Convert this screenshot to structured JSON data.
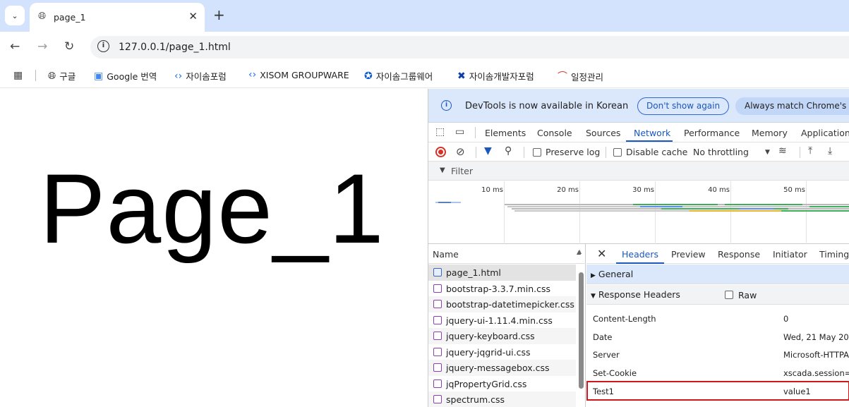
{
  "browser": {
    "tab_title": "page_1",
    "url": "127.0.0.1/page_1.html",
    "bookmarks": [
      {
        "label": "구글",
        "icon": "globe-icon"
      },
      {
        "label": "Google 번역",
        "icon": "translate-icon"
      },
      {
        "label": "자이솜포럼",
        "icon": "xisom-icon"
      },
      {
        "label": "XISOM GROUPWARE",
        "icon": "xisom-icon"
      },
      {
        "label": "자이솜그룹웨어",
        "icon": "groupware-icon"
      },
      {
        "label": "자이솜개발자포럼",
        "icon": "dev-forum-icon"
      },
      {
        "label": "일정관리",
        "icon": "calendar-icon"
      }
    ]
  },
  "page": {
    "heading": "Page_1"
  },
  "devtools": {
    "info_bar": {
      "message": "DevTools is now available in Korean",
      "dont_show": "Don't show again",
      "always_match": "Always match Chrome's la"
    },
    "tabs": [
      "Elements",
      "Console",
      "Sources",
      "Network",
      "Performance",
      "Memory",
      "Application"
    ],
    "active_tab": "Network",
    "network_bar": {
      "preserve_log": "Preserve log",
      "disable_cache": "Disable cache",
      "throttling": "No throttling"
    },
    "filter_placeholder": "Filter",
    "timeline_ticks": [
      "10 ms",
      "20 ms",
      "30 ms",
      "40 ms",
      "50 ms"
    ],
    "request_list": {
      "header": "Name",
      "items": [
        {
          "name": "page_1.html",
          "type": "document"
        },
        {
          "name": "bootstrap-3.3.7.min.css",
          "type": "stylesheet"
        },
        {
          "name": "bootstrap-datetimepicker.css",
          "type": "stylesheet"
        },
        {
          "name": "jquery-ui-1.11.4.min.css",
          "type": "stylesheet"
        },
        {
          "name": "jquery-keyboard.css",
          "type": "stylesheet"
        },
        {
          "name": "jquery-jqgrid-ui.css",
          "type": "stylesheet"
        },
        {
          "name": "jquery-messagebox.css",
          "type": "stylesheet"
        },
        {
          "name": "jqPropertyGrid.css",
          "type": "stylesheet"
        },
        {
          "name": "spectrum.css",
          "type": "stylesheet"
        }
      ]
    },
    "detail": {
      "tabs": [
        "Headers",
        "Preview",
        "Response",
        "Initiator",
        "Timing"
      ],
      "active_tab": "Headers",
      "general_label": "General",
      "response_headers_label": "Response Headers",
      "raw_label": "Raw",
      "headers": [
        {
          "key": "Content-Length",
          "value": "0"
        },
        {
          "key": "Date",
          "value": "Wed, 21 May 20"
        },
        {
          "key": "Server",
          "value": "Microsoft-HTTPA"
        },
        {
          "key": "Set-Cookie",
          "value": "xscada.session="
        },
        {
          "key": "Test1",
          "value": "value1"
        }
      ]
    }
  }
}
